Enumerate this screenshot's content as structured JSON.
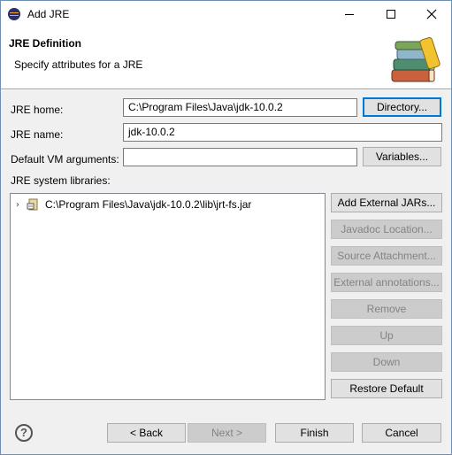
{
  "window": {
    "title": "Add JRE"
  },
  "header": {
    "title": "JRE Definition",
    "subtitle": "Specify attributes for a JRE",
    "icon": "books-icon"
  },
  "form": {
    "jre_home_label": "JRE home:",
    "jre_home_value": "C:\\Program Files\\Java\\jdk-10.0.2",
    "directory_button": "Directory...",
    "jre_name_label": "JRE name:",
    "jre_name_value": "jdk-10.0.2",
    "vm_args_label": "Default VM arguments:",
    "vm_args_value": "",
    "variables_button": "Variables...",
    "libraries_label": "JRE system libraries:"
  },
  "libraries": {
    "items": [
      {
        "path": "C:\\Program Files\\Java\\jdk-10.0.2\\lib\\jrt-fs.jar",
        "icon": "jar-icon",
        "expanded": false
      }
    ]
  },
  "side_buttons": {
    "add_external_jars": "Add External JARs...",
    "javadoc_location": "Javadoc Location...",
    "source_attachment": "Source Attachment...",
    "external_annotations": "External annotations...",
    "remove": "Remove",
    "up": "Up",
    "down": "Down",
    "restore_default": "Restore Default"
  },
  "footer": {
    "help": "?",
    "back": "< Back",
    "next": "Next >",
    "finish": "Finish",
    "cancel": "Cancel"
  },
  "colors": {
    "focus_border": "#0078d7",
    "dialog_bg": "#f0f0f0"
  }
}
